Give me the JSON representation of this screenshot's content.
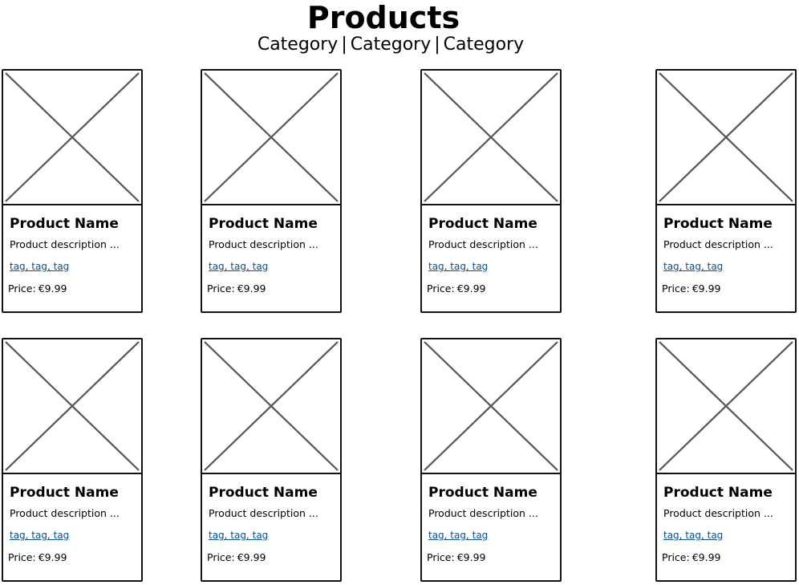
{
  "header": {
    "title": "Products",
    "categories": [
      "Category",
      "Category",
      "Category"
    ],
    "separator": "|"
  },
  "products": [
    {
      "name": "Product Name",
      "description": "Product description ...",
      "tags": "tag, tag, tag",
      "price_label": "Price:",
      "price": "€9.99"
    },
    {
      "name": "Product Name",
      "description": "Product description ...",
      "tags": "tag, tag, tag",
      "price_label": "Price:",
      "price": "€9.99"
    },
    {
      "name": "Product Name",
      "description": "Product description ...",
      "tags": "tag, tag, tag",
      "price_label": "Price:",
      "price": "€9.99"
    },
    {
      "name": "Product Name",
      "description": "Product description ...",
      "tags": "tag, tag, tag",
      "price_label": "Price:",
      "price": "€9.99"
    },
    {
      "name": "Product Name",
      "description": "Product description ...",
      "tags": "tag, tag, tag",
      "price_label": "Price:",
      "price": "€9.99"
    },
    {
      "name": "Product Name",
      "description": "Product description ...",
      "tags": "tag, tag, tag",
      "price_label": "Price:",
      "price": "€9.99"
    },
    {
      "name": "Product Name",
      "description": "Product description ...",
      "tags": "tag, tag, tag",
      "price_label": "Price:",
      "price": "€9.99"
    },
    {
      "name": "Product Name",
      "description": "Product description ...",
      "tags": "tag, tag, tag",
      "price_label": "Price:",
      "price": "€9.99"
    }
  ],
  "colors": {
    "outline": "#111111",
    "placeholder_cross": "#555555",
    "tag_link": "#0b4e92"
  }
}
